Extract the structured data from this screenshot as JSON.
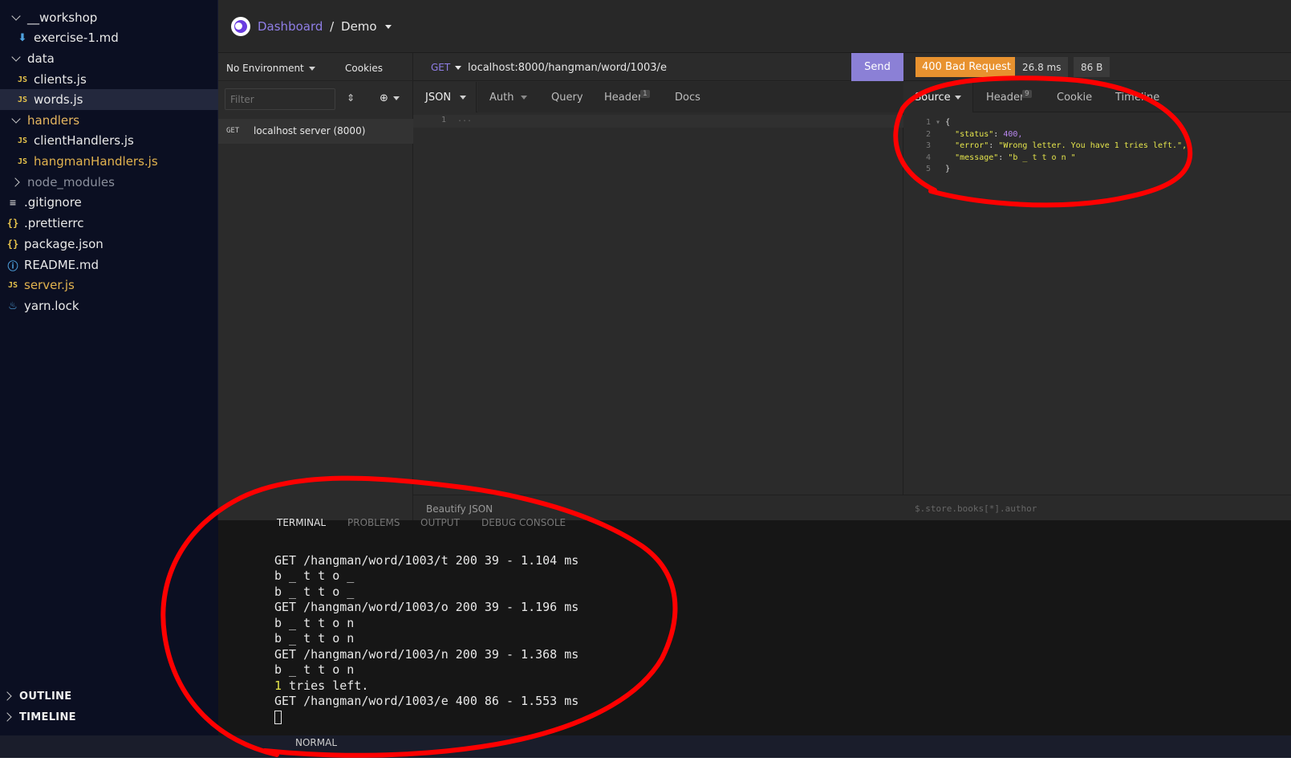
{
  "explorer": {
    "items": [
      {
        "label": "__workshop",
        "kind": "folder-open"
      },
      {
        "label": "exercise-1.md",
        "kind": "md"
      },
      {
        "label": "data",
        "kind": "folder-open"
      },
      {
        "label": "clients.js",
        "kind": "js"
      },
      {
        "label": "words.js",
        "kind": "js"
      },
      {
        "label": "handlers",
        "kind": "folder-open"
      },
      {
        "label": "clientHandlers.js",
        "kind": "js"
      },
      {
        "label": "hangmanHandlers.js",
        "kind": "js"
      },
      {
        "label": "node_modules",
        "kind": "folder-closed"
      },
      {
        "label": ".gitignore",
        "kind": "text"
      },
      {
        "label": ".prettierrc",
        "kind": "json"
      },
      {
        "label": "package.json",
        "kind": "json"
      },
      {
        "label": "README.md",
        "kind": "info"
      },
      {
        "label": "server.js",
        "kind": "js"
      },
      {
        "label": "yarn.lock",
        "kind": "yarn"
      }
    ],
    "outline_label": "OUTLINE",
    "timeline_label": "TIMELINE"
  },
  "insomnia": {
    "breadcrumb_dashboard": "Dashboard",
    "breadcrumb_sep": "/",
    "breadcrumb_workspace": "Demo",
    "environment": "No Environment",
    "cookies": "Cookies",
    "filter_placeholder": "Filter",
    "request_method": "GET",
    "request_name": "localhost server (8000)",
    "url_method": "GET",
    "url": "localhost:8000/hangman/word/1003/e",
    "send_label": "Send",
    "status": "400 Bad Request",
    "time": "26.8 ms",
    "size": "86 B",
    "request_tabs": {
      "body": "JSON",
      "auth": "Auth",
      "query": "Query",
      "header": "Header",
      "header_count": "1",
      "docs": "Docs"
    },
    "response_tabs": {
      "source": "Source",
      "header": "Header",
      "header_count": "9",
      "cookie": "Cookie",
      "timeline": "Timeline"
    },
    "editor_line": "1",
    "editor_placeholder": "...",
    "beautify_label": "Beautify JSON",
    "filter_query": "$.store.books[*].author",
    "response_lines": [
      {
        "n": "1",
        "text": "{"
      },
      {
        "n": "2",
        "key": "\"status\"",
        "value": "400,"
      },
      {
        "n": "3",
        "key": "\"error\"",
        "value": "\"Wrong letter. You have 1 tries left.\","
      },
      {
        "n": "4",
        "key": "\"message\"",
        "value": "\"b _ t t o n \""
      },
      {
        "n": "5",
        "text": "}"
      }
    ]
  },
  "terminal": {
    "tabs": [
      "TERMINAL",
      "PROBLEMS",
      "OUTPUT",
      "DEBUG CONSOLE"
    ],
    "lines": [
      "GET /hangman/word/1003/t 200 39 - 1.104 ms",
      "b _ t t o _",
      "b _ t t o _",
      "GET /hangman/word/1003/o 200 39 - 1.196 ms",
      "b _ t t o n",
      "b _ t t o n",
      "GET /hangman/word/1003/n 200 39 - 1.368 ms",
      "b _ t t o n",
      "1 tries left.",
      "GET /hangman/word/1003/e 400 86 - 1.553 ms"
    ]
  },
  "statusbar": {
    "mode": "NORMAL"
  },
  "colors": {
    "accent_purple": "#8f7ee6",
    "send_button": "#8b80d6",
    "status_bad": "#e8922f",
    "annotation_red": "#ff0000"
  }
}
